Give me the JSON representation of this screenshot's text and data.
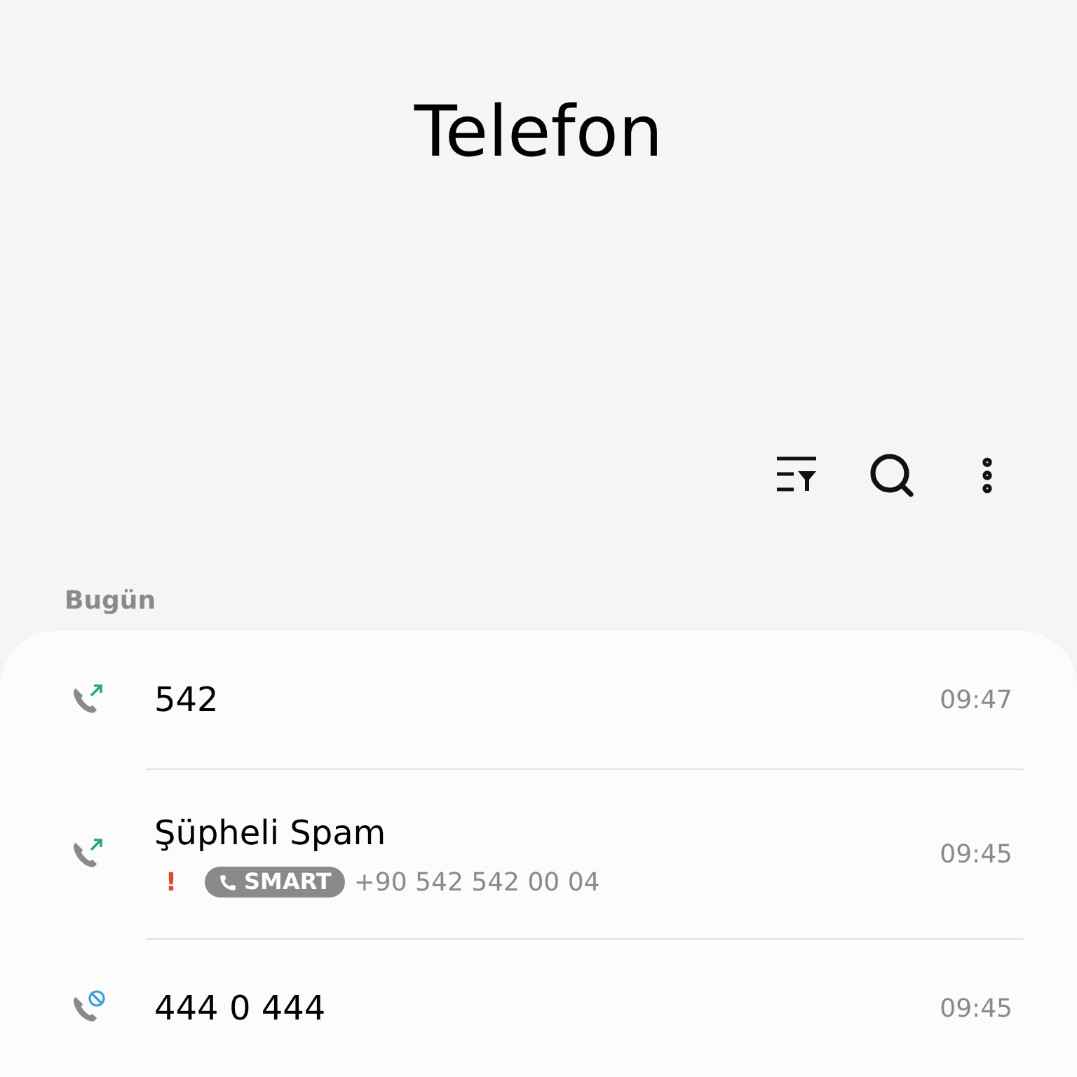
{
  "title": "Telefon",
  "section": "Bugün",
  "calls": [
    {
      "kind": "outgoing",
      "name": "542",
      "time": "09:47"
    },
    {
      "kind": "outgoing",
      "name": "Şüpheli Spam",
      "warning": "!",
      "tag": "SMART",
      "number": "+90 542 542 00 04",
      "time": "09:45"
    },
    {
      "kind": "blocked",
      "name": "444 0 444",
      "time": "09:45"
    }
  ]
}
